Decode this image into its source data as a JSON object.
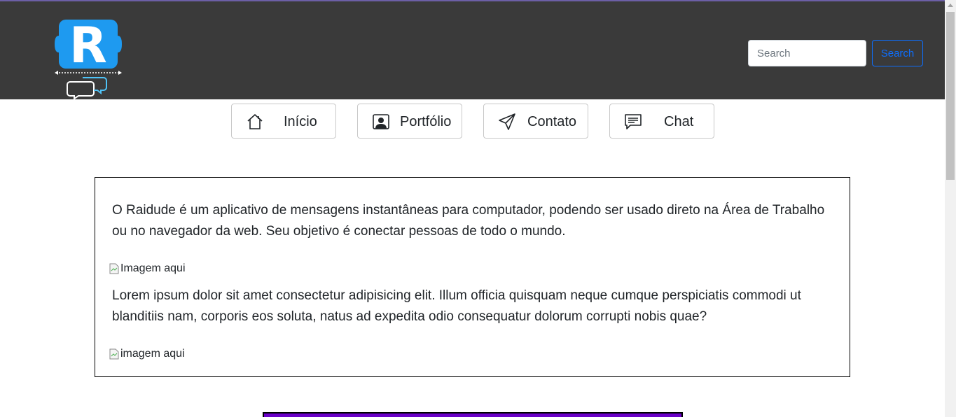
{
  "header": {
    "logo_letter": "R",
    "search": {
      "placeholder": "Search",
      "value": "",
      "button_label": "Search"
    }
  },
  "nav": {
    "items": [
      {
        "label": "Início",
        "icon": "home-icon"
      },
      {
        "label": "Portfólio",
        "icon": "portfolio-icon"
      },
      {
        "label": "Contato",
        "icon": "send-icon"
      },
      {
        "label": "Chat",
        "icon": "chat-icon"
      }
    ]
  },
  "content": {
    "paragraph1": "O Raidude é um aplicativo de mensagens instantâneas para computador, podendo ser usado direto na Área de Trabalho ou no navegador da web. Seu objetivo é conectar pessoas de todo o mundo.",
    "image1_alt": "Imagem aqui",
    "paragraph2": "Lorem ipsum dolor sit amet consectetur adipisicing elit. Illum officia quisquam neque cumque perspiciatis commodi ut blanditiis nam, corporis eos soluta, natus ad expedita odio consequatur dolorum corrupti nobis quae?",
    "image2_alt": "imagem aqui"
  },
  "colors": {
    "header_bg": "#3a3a3a",
    "accent_blue": "#0d6efd",
    "logo_blue": "#2196f3",
    "footer_purple": "#6a00c8"
  }
}
